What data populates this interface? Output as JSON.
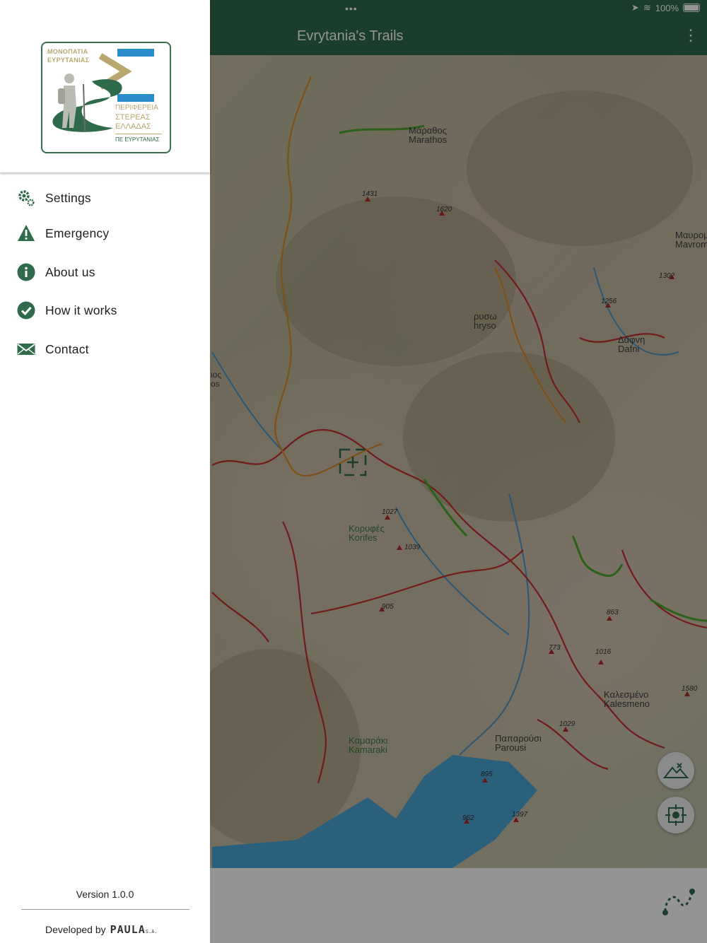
{
  "app": {
    "title": "Evrytania's Trails",
    "status_battery": "100%"
  },
  "drawer": {
    "logo": {
      "line1": "ΜΟΝΟΠΑΤΙΑ",
      "line2": "ΕΥΡΥΤΑΝΙΑΣ",
      "region1": "ΠΕΡΙΦΕΡΕΙΑ",
      "region2": "ΣΤΕΡΕΑΣ",
      "region3": "ΕΛΛΑΔΑΣ",
      "region4": "ΠΕ ΕΥΡΥΤΑΝΙΑΣ"
    },
    "menu": [
      {
        "label": "Settings",
        "icon": "gears-icon"
      },
      {
        "label": "Emergency",
        "icon": "warning-icon"
      },
      {
        "label": "About us",
        "icon": "info-icon"
      },
      {
        "label": "How it works",
        "icon": "check-circle-icon"
      },
      {
        "label": "Contact",
        "icon": "envelope-icon"
      }
    ],
    "version": "Version 1.0.0",
    "developed_by": "Developed by",
    "company": "PAULA",
    "company_suffix": "S.A."
  },
  "map": {
    "labels": {
      "marathos": "Μάραθος\nMarathos",
      "chryso": "ρυσω\nhryso",
      "dafni": "Δάφνη\nDafni",
      "mavrom": "Μαυρομμ\nMavromm",
      "korifes": "Κορυφές\nKorifes",
      "kalesmeno": "Καλεσμένο\nKalesmeno",
      "paparousi": "Παπαρούσι\nParousi",
      "kamaraki": "Καμαράκι\nKamaraki",
      "left_edge": "ιος\nos"
    },
    "elevations": [
      "1431",
      "1620",
      "1302",
      "1256",
      "1027",
      "1039",
      "905",
      "863",
      "773",
      "1016",
      "1580",
      "1029",
      "895",
      "962",
      "1397"
    ]
  },
  "colors": {
    "primary": "#2f6a4b",
    "trail_red": "#c2302e",
    "trail_orange": "#d98b2b",
    "trail_green": "#4aa52e",
    "water": "#4aa6d8"
  }
}
